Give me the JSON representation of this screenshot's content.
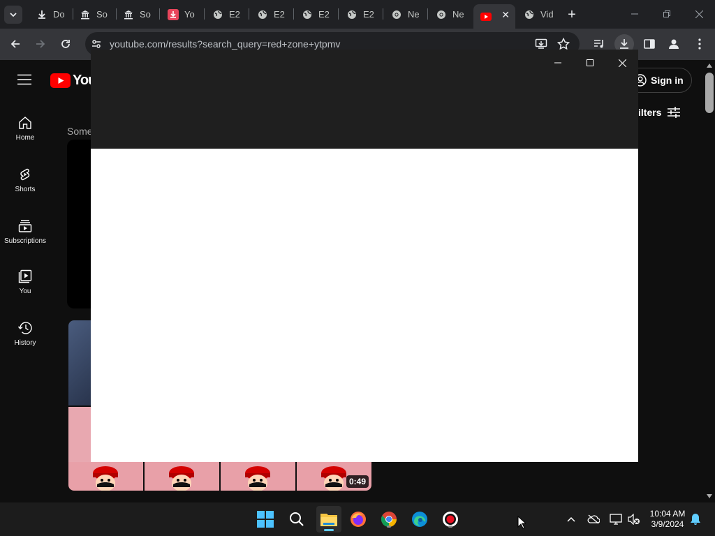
{
  "browser": {
    "tabs": [
      {
        "label": "Do",
        "icon": "download-icon"
      },
      {
        "label": "So",
        "icon": "bank-icon"
      },
      {
        "label": "So",
        "icon": "bank-icon"
      },
      {
        "label": "Yo",
        "icon": "pdf-download-icon"
      },
      {
        "label": "E2",
        "icon": "globe-icon"
      },
      {
        "label": "E2",
        "icon": "globe-icon"
      },
      {
        "label": "E2",
        "icon": "globe-icon"
      },
      {
        "label": "E2",
        "icon": "globe-icon"
      },
      {
        "label": "Ne",
        "icon": "chrome-icon"
      },
      {
        "label": "Ne",
        "icon": "chrome-icon"
      },
      {
        "label": "",
        "icon": "youtube-icon",
        "active": true
      },
      {
        "label": "Vid",
        "icon": "globe-icon"
      }
    ],
    "url": "youtube.com/results?search_query=red+zone+ytpmv"
  },
  "youtube": {
    "logo_text": "You",
    "sign_in": "Sign in",
    "filters": "ilters",
    "section_label": "Some",
    "sidebar": [
      {
        "label": "Home",
        "icon": "home-icon"
      },
      {
        "label": "Shorts",
        "icon": "shorts-icon"
      },
      {
        "label": "Subscriptions",
        "icon": "subscriptions-icon"
      },
      {
        "label": "You",
        "icon": "you-icon"
      },
      {
        "label": "History",
        "icon": "history-icon"
      }
    ],
    "video_duration": "0:49"
  },
  "taskbar": {
    "time": "10:04 AM",
    "date": "3/9/2024"
  },
  "colors": {
    "youtube_red": "#ff0000",
    "chrome_tab_bg": "#202124",
    "toolbar_bg": "#35363a",
    "youtube_bg": "#0f0f0f",
    "taskbar_bg": "#1c1c1c"
  }
}
